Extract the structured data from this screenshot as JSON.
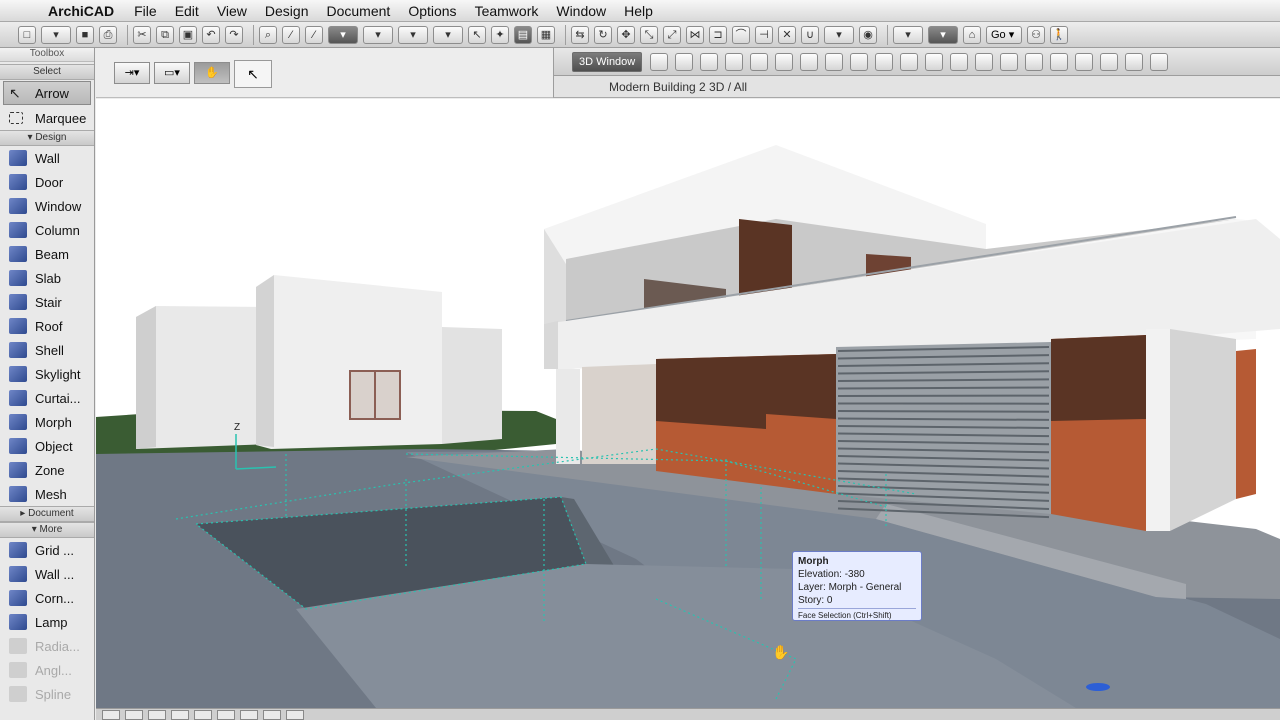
{
  "menubar": {
    "app_name": "ArchiCAD",
    "items": [
      "File",
      "Edit",
      "View",
      "Design",
      "Document",
      "Options",
      "Teamwork",
      "Window",
      "Help"
    ]
  },
  "toolbox": {
    "title": "Toolbox",
    "select_header": "Select",
    "select_tools": [
      "Arrow",
      "Marquee"
    ],
    "design_header": "Design",
    "design_tools": [
      "Wall",
      "Door",
      "Window",
      "Column",
      "Beam",
      "Slab",
      "Stair",
      "Roof",
      "Shell",
      "Skylight",
      "Curtai...",
      "Morph",
      "Object",
      "Zone",
      "Mesh"
    ],
    "document_header": "Document",
    "more_header": "More",
    "more_tools": [
      "Grid ...",
      "Wall ...",
      "Corn...",
      "Lamp"
    ],
    "more_tools_dim": [
      "Radia...",
      "Angl...",
      "Spline"
    ]
  },
  "window": {
    "view_button": "3D Window",
    "title": "Modern Building 2 3D / All"
  },
  "toolbar": {
    "go_label": "Go"
  },
  "tooltip": {
    "title": "Morph",
    "elevation": "Elevation: -380",
    "layer": "Layer: Morph - General",
    "story": "Story: 0",
    "hint": "Face Selection (Ctrl+Shift)"
  },
  "axis_label": "Z",
  "colors": {
    "wireframe": "#29c2b0",
    "wood": "#5a3424",
    "terracotta": "#b65a34",
    "pavement": "#6f7885"
  }
}
